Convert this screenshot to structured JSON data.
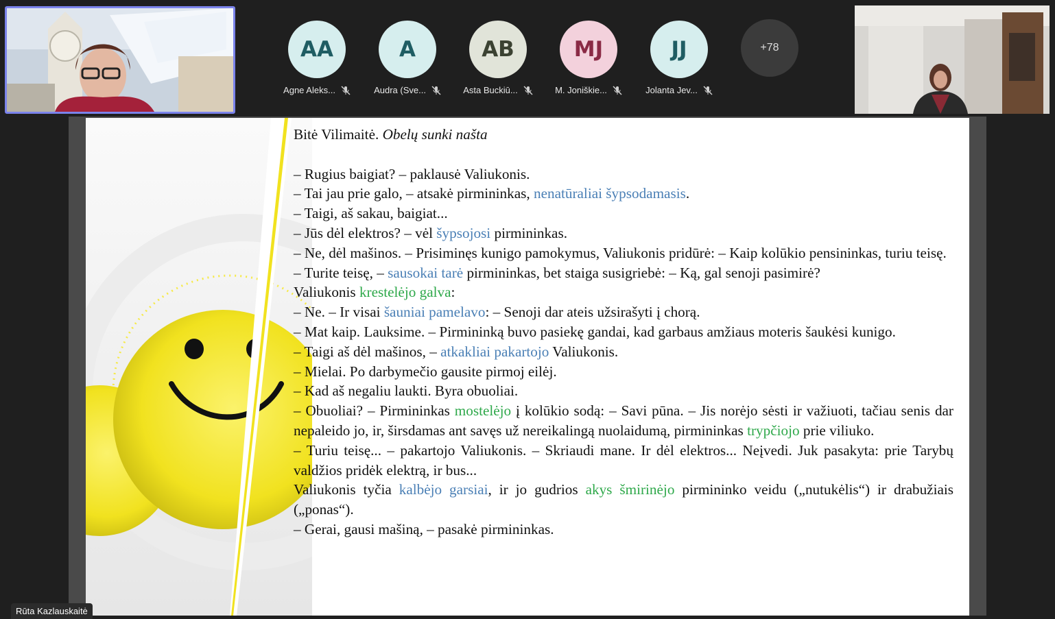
{
  "participants": [
    {
      "initials": "AA",
      "name": "Agne Aleks...",
      "bg": "#d6eeee",
      "fg": "#1f5d63"
    },
    {
      "initials": "A",
      "name": "Audra (Sve...",
      "bg": "#d6eeee",
      "fg": "#1f5d63"
    },
    {
      "initials": "AB",
      "name": "Asta Buckiū...",
      "bg": "#e1e4d9",
      "fg": "#3b4232"
    },
    {
      "initials": "MJ",
      "name": "M. Joniškie...",
      "bg": "#f3d1dc",
      "fg": "#8a2a45"
    },
    {
      "initials": "JJ",
      "name": "Jolanta Jev...",
      "bg": "#d6eeee",
      "fg": "#1f5d63"
    }
  ],
  "overflow_count": "+78",
  "presenter_name": "Rūta Kazlauskaitė",
  "slide": {
    "title_author": "Bitė Vilimaitė. ",
    "title_work": "Obelų sunki našta",
    "l1": "– Rugius baigiat? – paklausė Valiukonis.",
    "l2a": "– Tai jau prie galo, – atsakė pirmininkas, ",
    "l2b": "nenatūraliai šypsodamasis",
    "l2c": ".",
    "l3": "– Taigi, aš sakau, baigiat...",
    "l4a": "– Jūs dėl elektros? – vėl ",
    "l4b": "šypsojosi",
    "l4c": " pirmininkas.",
    "l5": "– Ne, dėl mašinos. – Prisiminęs kunigo pamokymus, Valiukonis pridūrė: – Kaip kolūkio pensininkas, turiu teisę.",
    "l6a": "– Turite teisę, – ",
    "l6b": "sausokai tarė",
    "l6c": " pirmininkas, bet staiga susigriebė: – Ką, gal senoji pasimirė?",
    "l7a": "Valiukonis ",
    "l7b": "krestelėjo galva",
    "l7c": ":",
    "l8a": "– Ne. – Ir visai ",
    "l8b": "šauniai pamelavo",
    "l8c": ": – Senoji dar ateis užsirašyti į chorą.",
    "l9": "– Mat kaip. Lauksime. – Pirmininką buvo pasiekę gandai, kad garbaus amžiaus moteris šaukėsi kunigo.",
    "l10a": "– Taigi aš dėl mašinos, – ",
    "l10b": "atkakliai pakartojo",
    "l10c": " Valiukonis.",
    "l11": "– Mielai. Po darbymečio gausite pirmoj eilėj.",
    "l12": "– Kad aš negaliu laukti. Byra obuoliai.",
    "l13a": "– Obuoliai? – Pirmininkas ",
    "l13b": "mostelėjo",
    "l13c": " į kolūkio sodą: – Savi pūna. – Jis norėjo sėsti ir važiuoti, tačiau senis dar nepaleido jo, ir, širsdamas ant savęs už nereikalingą nuolaidumą, pirmininkas ",
    "l13d": "trypčiojo",
    "l13e": " prie viliuko.",
    "l14": "– Turiu teisę... – pakartojo Valiukonis. – Skriaudi mane. Ir dėl elektros... Neįvedi. Juk pasakyta: prie Tarybų valdžios pridėk elektrą, ir bus...",
    "l15a": "Valiukonis tyčia ",
    "l15b": "kalbėjo garsiai",
    "l15c": ", ir jo gudrios ",
    "l15d": "akys šmirinėjo",
    "l15e": " pirmininko veidu („nutukėlis“) ir drabužiais („ponas“).",
    "l16": "– Gerai, gausi mašiną, – pasakė pirmininkas."
  }
}
